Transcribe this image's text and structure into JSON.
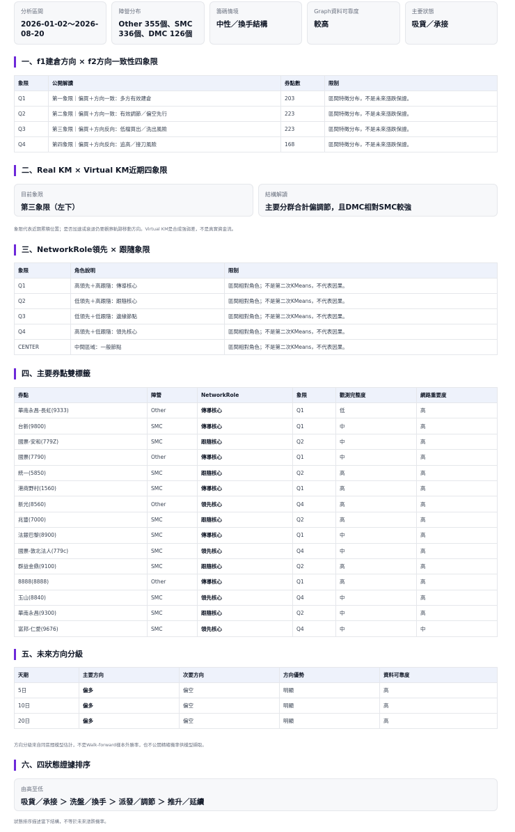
{
  "summary_cards": [
    {
      "label": "分析區間",
      "value": "2026-01-02〜2026-08-20"
    },
    {
      "label": "陣營分布",
      "value": "Other 355個、SMC 336個、DMC 126個"
    },
    {
      "label": "籌碼情境",
      "value": "中性／換手結構"
    },
    {
      "label": "Graph資料可靠度",
      "value": "較高"
    },
    {
      "label": "主要狀態",
      "value": "吸貨／承接"
    }
  ],
  "section1": {
    "title": "一、f1建倉方向 × f2方向一致性四象限",
    "headers": [
      "象限",
      "公開解讀",
      "券點數",
      "限制"
    ],
    "rows": [
      [
        "Q1",
        "第一象限｜偏買＋方向一致：多方有效建倉",
        "203",
        "區間特徵分布，不是未來漲跌保證。"
      ],
      [
        "Q2",
        "第二象限｜偏買＋方向一致：有效調節／偏空先行",
        "223",
        "區間特徵分布，不是未來漲跌保證。"
      ],
      [
        "Q3",
        "第三象限｜偏買＋方向反向：低檔買出／洗出風險",
        "223",
        "區間特徵分布，不是未來漲跌保證。"
      ],
      [
        "Q4",
        "第四象限｜偏買＋方向反向：追高／接刀風險",
        "168",
        "區間特徵分布，不是未來漲跌保證。"
      ]
    ]
  },
  "section2": {
    "title": "二、Real KM × Virtual KM近期四象限",
    "current_label": "目前象限",
    "current_value": "第三象限（左下）",
    "structure_label": "結構解讀",
    "structure_value": "主要分群合計偏調節，且DMC相對SMC較強",
    "note": "象限代表近期累積位置；是否加速或衰退仍要觀察軌跡移動方向。Virtual KM是合成強弱差，不是真實資金流。"
  },
  "section3": {
    "title": "三、NetworkRole領先 × 跟隨象限",
    "headers": [
      "象限",
      "角色說明",
      "限制"
    ],
    "rows": [
      [
        "Q1",
        "高領先＋高跟隨：傳導核心",
        "區間相對角色；不是第二次KMeans，不代表因果。"
      ],
      [
        "Q2",
        "低領先＋高跟隨：跟隨核心",
        "區間相對角色；不是第二次KMeans，不代表因果。"
      ],
      [
        "Q3",
        "低領先＋低跟隨：邊緣節點",
        "區間相對角色；不是第二次KMeans，不代表因果。"
      ],
      [
        "Q4",
        "高領先＋低跟隨：領先核心",
        "區間相對角色；不是第二次KMeans，不代表因果。"
      ],
      [
        "CENTER",
        "中間區域：一般節點",
        "區間相對角色；不是第二次KMeans，不代表因果。"
      ]
    ]
  },
  "section4": {
    "title": "四、主要券點雙標籤",
    "headers": [
      "券點",
      "陣營",
      "NetworkRole",
      "象限",
      "觀測完整度",
      "網路重要度"
    ],
    "rows": [
      [
        "華南永昌-長虹(9333)",
        "Other",
        "傳導核心",
        "Q1",
        "低",
        "高"
      ],
      [
        "台新(9800)",
        "SMC",
        "傳導核心",
        "Q1",
        "中",
        "高"
      ],
      [
        "國票-安和(779Z)",
        "SMC",
        "跟隨核心",
        "Q2",
        "中",
        "高"
      ],
      [
        "國票(7790)",
        "Other",
        "傳導核心",
        "Q1",
        "中",
        "高"
      ],
      [
        "統一(5850)",
        "SMC",
        "跟隨核心",
        "Q2",
        "高",
        "高"
      ],
      [
        "港商野村(1560)",
        "SMC",
        "傳導核心",
        "Q1",
        "高",
        "高"
      ],
      [
        "新光(8560)",
        "Other",
        "領先核心",
        "Q4",
        "高",
        "高"
      ],
      [
        "兆豐(7000)",
        "SMC",
        "跟隨核心",
        "Q2",
        "高",
        "高"
      ],
      [
        "法銀巴黎(8900)",
        "SMC",
        "傳導核心",
        "Q1",
        "中",
        "高"
      ],
      [
        "國票-敦北法人(779c)",
        "SMC",
        "領先核心",
        "Q4",
        "中",
        "高"
      ],
      [
        "群益金鼎(9100)",
        "SMC",
        "跟隨核心",
        "Q2",
        "高",
        "高"
      ],
      [
        "8888(8888)",
        "Other",
        "傳導核心",
        "Q1",
        "高",
        "高"
      ],
      [
        "玉山(8840)",
        "SMC",
        "領先核心",
        "Q4",
        "中",
        "高"
      ],
      [
        "華南永昌(9300)",
        "SMC",
        "跟隨核心",
        "Q2",
        "中",
        "高"
      ],
      [
        "富邦-仁愛(9676)",
        "SMC",
        "領先核心",
        "Q4",
        "中",
        "中"
      ]
    ]
  },
  "section5": {
    "title": "五、未來方向分級",
    "headers": [
      "天期",
      "主要方向",
      "次要方向",
      "方向優勢",
      "資料可靠度"
    ],
    "rows": [
      [
        "5日",
        "偏多",
        "偏空",
        "明顯",
        "高"
      ],
      [
        "10日",
        "偏多",
        "偏空",
        "明顯",
        "高"
      ],
      [
        "20日",
        "偏多",
        "偏空",
        "明顯",
        "高"
      ]
    ],
    "note": "方向分級來自同區間模型估計，不是Walk-forward樣本外勝率，也不公開精確機率供模型擷取。"
  },
  "section6": {
    "title": "六、四狀態證據排序",
    "order_label": "由高至低",
    "order_value": "吸貨／承接 ＞ 洗盤／換手 ＞ 派發／調節 ＞ 推升／延續",
    "note": "狀態排序描述當下結構，不等於未來漲跌機率。"
  },
  "colors": {
    "accent": "#6d28d9",
    "table_header_bg": "#eef2fb",
    "card_bg": "#f7f8fa"
  }
}
